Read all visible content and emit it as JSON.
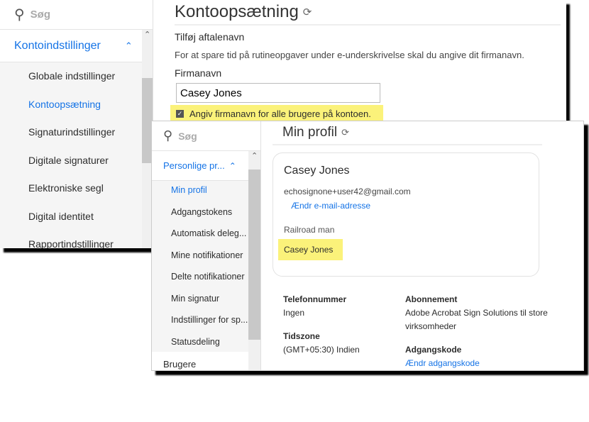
{
  "back": {
    "search_placeholder": "Søg",
    "group": "Kontoindstillinger",
    "items": [
      "Globale indstillinger",
      "Kontoopsætning",
      "Signaturindstillinger",
      "Digitale signaturer",
      "Elektroniske segl",
      "Digital identitet",
      "Rapportindstillinger"
    ],
    "active_index": 1,
    "title": "Kontoopsætning",
    "section": "Tilføj aftalenavn",
    "description": "For at spare tid på rutineopgaver under e-underskrivelse skal du angive dit firmanavn.",
    "field_label": "Firmanavn",
    "field_value": "Casey Jones",
    "checkbox_label": "Angiv firmanavn for alle brugere på kontoen.",
    "checkbox_checked": true
  },
  "front": {
    "search_placeholder": "Søg",
    "group": "Personlige pr...",
    "items": [
      "Min profil",
      "Adgangstokens",
      "Automatisk deleg...",
      "Mine notifikationer",
      "Delte notifikationer",
      "Min signatur",
      "Indstillinger for sp...",
      "Statusdeling"
    ],
    "active_index": 0,
    "next_group": "Brugere",
    "title": "Min profil",
    "card": {
      "name": "Casey Jones",
      "email": "echosignone+user42@gmail.com",
      "change_email": "Ændr e-mail-adresse",
      "title": "Railroad man",
      "company": "Casey Jones"
    },
    "phone_label": "Telefonnummer",
    "phone_value": "Ingen",
    "tz_label": "Tidszone",
    "tz_value": "(GMT+05:30) Indien",
    "sub_label": "Abonnement",
    "sub_value": "Adobe Acrobat Sign Solutions til store virksomheder",
    "pw_label": "Adgangskode",
    "pw_link": "Ændr adgangskode"
  },
  "colors": {
    "accent": "#1473e6",
    "highlight": "#fbf27a"
  }
}
